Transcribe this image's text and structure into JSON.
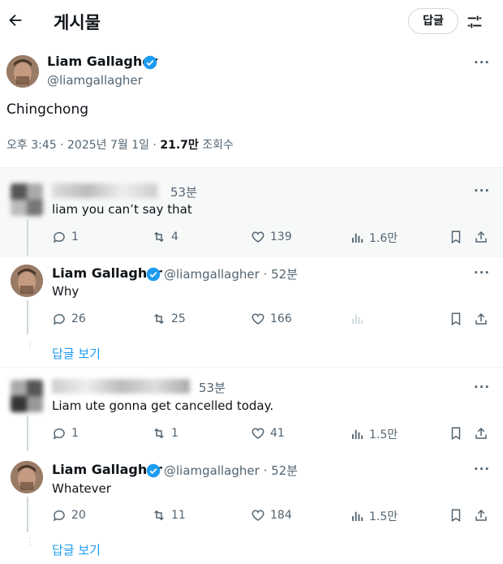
{
  "header": {
    "title": "게시물",
    "reply_button": "답글"
  },
  "main_post": {
    "author_name": "Liam Gallagher",
    "handle": "@liamgallagher",
    "text": "Chingchong",
    "time": "오후 3:45",
    "date": "2025년 7월 1일",
    "views_count": "21.7만",
    "views_label": "조회수"
  },
  "replies": [
    {
      "time": "53분",
      "text": "liam you can’t say that",
      "comments": "1",
      "retweets": "4",
      "likes": "139",
      "views": "1.6만"
    },
    {
      "author_name": "Liam Gallagher",
      "handle": "@liamgallagher · 52분",
      "text": "Why",
      "comments": "26",
      "retweets": "25",
      "likes": "166",
      "views": ""
    },
    {
      "time": "53분",
      "text": "Liam ute gonna get cancelled today.",
      "comments": "1",
      "retweets": "1",
      "likes": "41",
      "views": "1.5만"
    },
    {
      "author_name": "Liam Gallagher",
      "handle": "@liamgallagher · 52분",
      "text": "Whatever",
      "comments": "20",
      "retweets": "11",
      "likes": "184",
      "views": "1.5만"
    }
  ],
  "show_replies": [
    "답글 보기",
    "답글 보기"
  ],
  "colors": {
    "accent": "#1d9bf0",
    "muted": "#536471",
    "divider": "#eff3f4"
  }
}
